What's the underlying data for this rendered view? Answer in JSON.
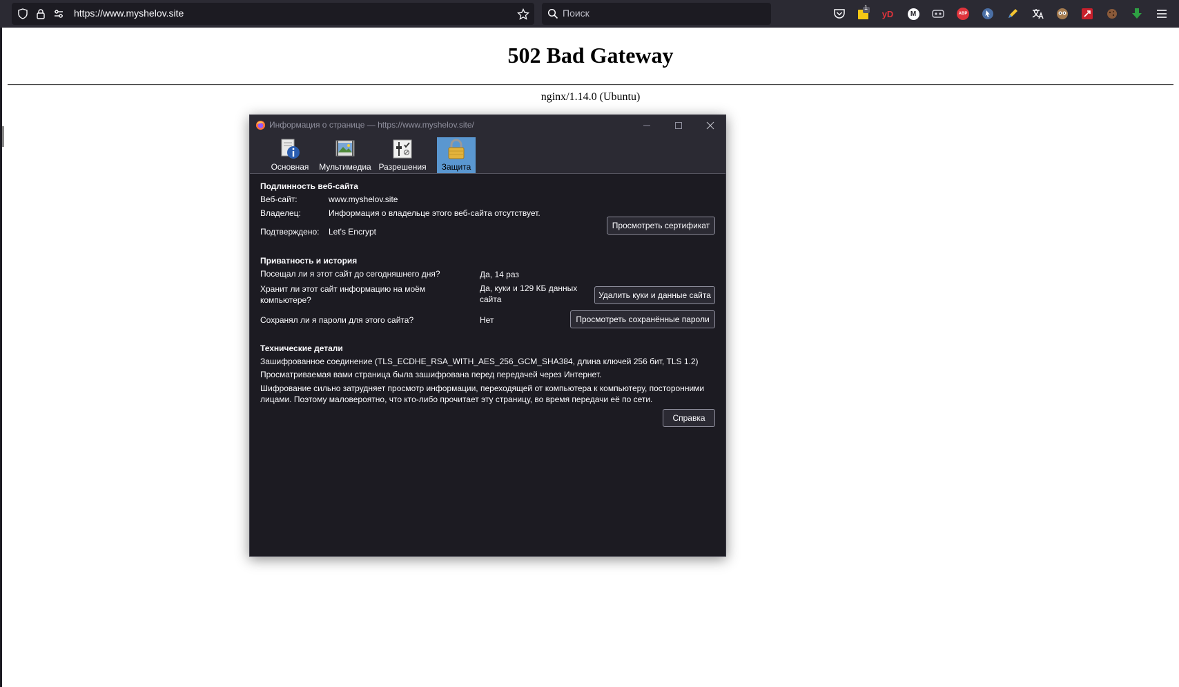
{
  "browser": {
    "url": "https://www.myshelov.site",
    "search_placeholder": "Поиск",
    "colors": {
      "toolbar": "#2b2a33",
      "field": "#1c1b22",
      "text": "#fbfbfe"
    },
    "extensions": [
      {
        "name": "pocket-icon"
      },
      {
        "name": "notes-extension-icon",
        "badge": "1"
      },
      {
        "name": "yandex-extension-icon",
        "text": "yD"
      },
      {
        "name": "m-extension-icon",
        "text": "M"
      },
      {
        "name": "masks-extension-icon"
      },
      {
        "name": "adblock-plus-icon",
        "text": "ABP"
      },
      {
        "name": "cursor-extension-icon"
      },
      {
        "name": "pencil-extension-icon"
      },
      {
        "name": "translate-extension-icon"
      },
      {
        "name": "owl-extension-icon"
      },
      {
        "name": "red-extension-icon"
      },
      {
        "name": "cookie-extension-icon"
      },
      {
        "name": "download-extension-icon"
      },
      {
        "name": "hamburger-menu-icon"
      }
    ]
  },
  "page": {
    "title": "502 Bad Gateway",
    "server": "nginx/1.14.0 (Ubuntu)"
  },
  "dialog": {
    "title": "Информация о странице — https://www.myshelov.site/",
    "tabs": [
      {
        "label": "Основная",
        "icon": "info-icon"
      },
      {
        "label": "Мультимедиа",
        "icon": "media-icon"
      },
      {
        "label": "Разрешения",
        "icon": "permissions-icon"
      },
      {
        "label": "Защита",
        "icon": "lock-icon",
        "selected": true
      }
    ],
    "identity": {
      "heading": "Подлинность веб-сайта",
      "website_label": "Веб-сайт:",
      "website_value": "www.myshelov.site",
      "owner_label": "Владелец:",
      "owner_value": "Информация о владельце этого веб-сайта отсутствует.",
      "verified_label": "Подтверждено:",
      "verified_value": "Let's Encrypt",
      "view_cert_button": "Просмотреть сертификат"
    },
    "privacy": {
      "heading": "Приватность и история",
      "visited_q": "Посещал ли я этот сайт до сегодняшнего дня?",
      "visited_a": "Да, 14 раз",
      "storage_q1": "Хранит ли этот сайт информацию на моём",
      "storage_q2": "компьютере?",
      "storage_a1": "Да, куки и 129 КБ данных",
      "storage_a2": "сайта",
      "clear_button": "Удалить куки и данные сайта",
      "passwords_q": "Сохранял ли я пароли для этого сайта?",
      "passwords_a": "Нет",
      "passwords_button": "Просмотреть сохранённые пароли"
    },
    "technical": {
      "heading": "Технические детали",
      "line1": "Зашифрованное соединение (TLS_ECDHE_RSA_WITH_AES_256_GCM_SHA384, длина ключей 256 бит, TLS 1.2)",
      "line2": "Просматриваемая вами страница была зашифрована перед передачей через Интернет.",
      "line3": "Шифрование сильно затрудняет просмотр информации, переходящей от компьютера к компьютеру, посторонними",
      "line4": "лицами. Поэтому маловероятно, что кто-либо прочитает эту страницу, во время передачи её по сети.",
      "help_button": "Справка"
    }
  }
}
